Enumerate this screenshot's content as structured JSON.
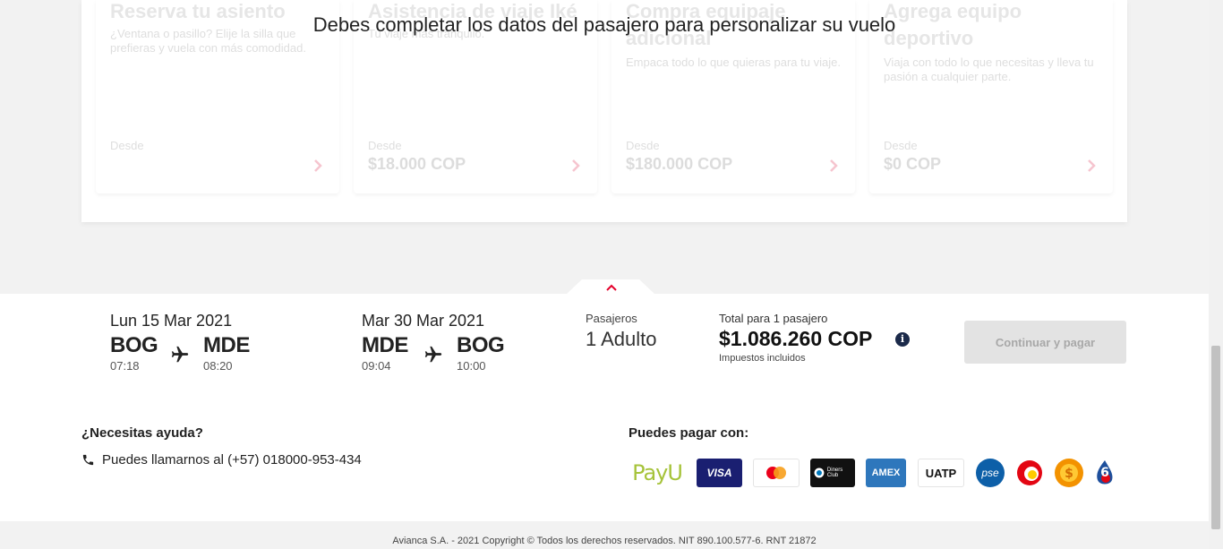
{
  "overlay_message": "Debes completar los datos del pasajero para personalizar su vuelo",
  "services": [
    {
      "title": "Reserva tu asiento",
      "description": "¿Ventana o pasillo? Elije la silla que prefieras y vuela con más comodidad.",
      "from_label": "Desde",
      "price": ""
    },
    {
      "title": "Asistencia de viaje Iké",
      "description": "Tu viaje más tranquilo.",
      "from_label": "Desde",
      "price": "$18.000 COP"
    },
    {
      "title": "Compra equipaje adicional",
      "description": "Empaca todo lo que quieras para tu viaje.",
      "from_label": "Desde",
      "price": "$180.000 COP"
    },
    {
      "title": "Agrega equipo deportivo",
      "description": "Viaja con todo lo que necesitas y lleva tu pasión a cualquier parte.",
      "from_label": "Desde",
      "price": "$0 COP"
    }
  ],
  "outbound": {
    "date": "Lun 15 Mar 2021",
    "origin": "BOG",
    "origin_time": "07:18",
    "destination": "MDE",
    "destination_time": "08:20"
  },
  "return": {
    "date": "Mar 30 Mar 2021",
    "origin": "MDE",
    "origin_time": "09:04",
    "destination": "BOG",
    "destination_time": "10:00"
  },
  "passengers": {
    "label": "Pasajeros",
    "value": "1 Adulto"
  },
  "total": {
    "label": "Total para 1 pasajero",
    "value": "$1.086.260 COP",
    "taxes_note": "Impuestos incluidos",
    "info_glyph": "i"
  },
  "pay_button": "Continuar y pagar",
  "help": {
    "title": "¿Necesitas ayuda?",
    "phone_text": "Puedes llamarnos al (+57) 018000-953-434"
  },
  "payments": {
    "title": "Puedes pagar con:",
    "methods": [
      {
        "name": "PayU",
        "label": "PayU"
      },
      {
        "name": "Visa",
        "label": "VISA"
      },
      {
        "name": "Mastercard",
        "label": ""
      },
      {
        "name": "Diners Club",
        "label": "Diners Club"
      },
      {
        "name": "American Express",
        "label": "AMEX"
      },
      {
        "name": "UATP",
        "label": "UATP"
      },
      {
        "name": "PSE",
        "label": "pse"
      }
    ]
  },
  "colors": {
    "accent_red": "#e4002b",
    "visa_blue": "#1a1f71",
    "amex_blue": "#2e77bc",
    "pse_blue": "#0d5fa8",
    "disabled_button": "#e3e3e3"
  },
  "copyright": "Avianca S.A. - 2021 Copyright © Todos los derechos reservados. NIT 890.100.577-6. RNT 21872"
}
